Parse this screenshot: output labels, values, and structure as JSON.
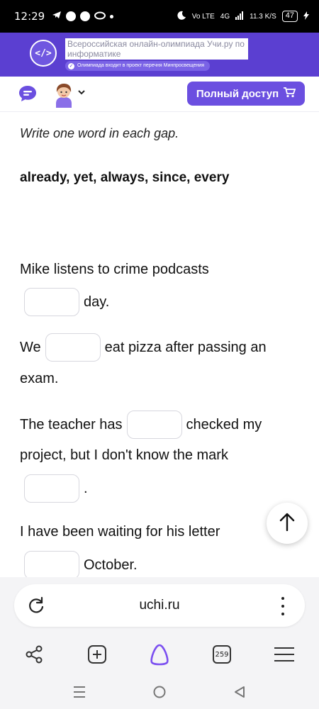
{
  "status_bar": {
    "time": "12:29",
    "network": "Vo LTE",
    "signal": "4G",
    "speed": "11.3 K/S",
    "battery": "47"
  },
  "banner": {
    "logo_text": "</>",
    "title": "Всероссийская онлайн-олимпиада Учи.ру по информатике",
    "note": "Олимпиада входит в проект перечня Минпросвещения"
  },
  "header": {
    "full_access_label": "Полный доступ",
    "icons": [
      "chat-icon",
      "avatar",
      "chevron-down-icon",
      "cart-icon"
    ]
  },
  "exercise": {
    "instruction": "Write one word in each gap.",
    "word_bank": "already, yet, always, since, every",
    "s1_part1": "Mike listens to crime podcasts",
    "s1_part2": "day.",
    "s2_part1": "We",
    "s2_part2": "eat pizza after passing an",
    "s2_part3": "exam.",
    "s3_part1": "The teacher has",
    "s3_part2": "checked my",
    "s3_part3": "project, but I don't know the mark",
    "s3_part4": ".",
    "s4_part1": "I have been waiting for his letter",
    "s4_part2": "October."
  },
  "browser": {
    "url": "uchi.ru",
    "tab_count": "259"
  },
  "colors": {
    "brand": "#5b3fd1",
    "button": "#6b4fe0"
  }
}
